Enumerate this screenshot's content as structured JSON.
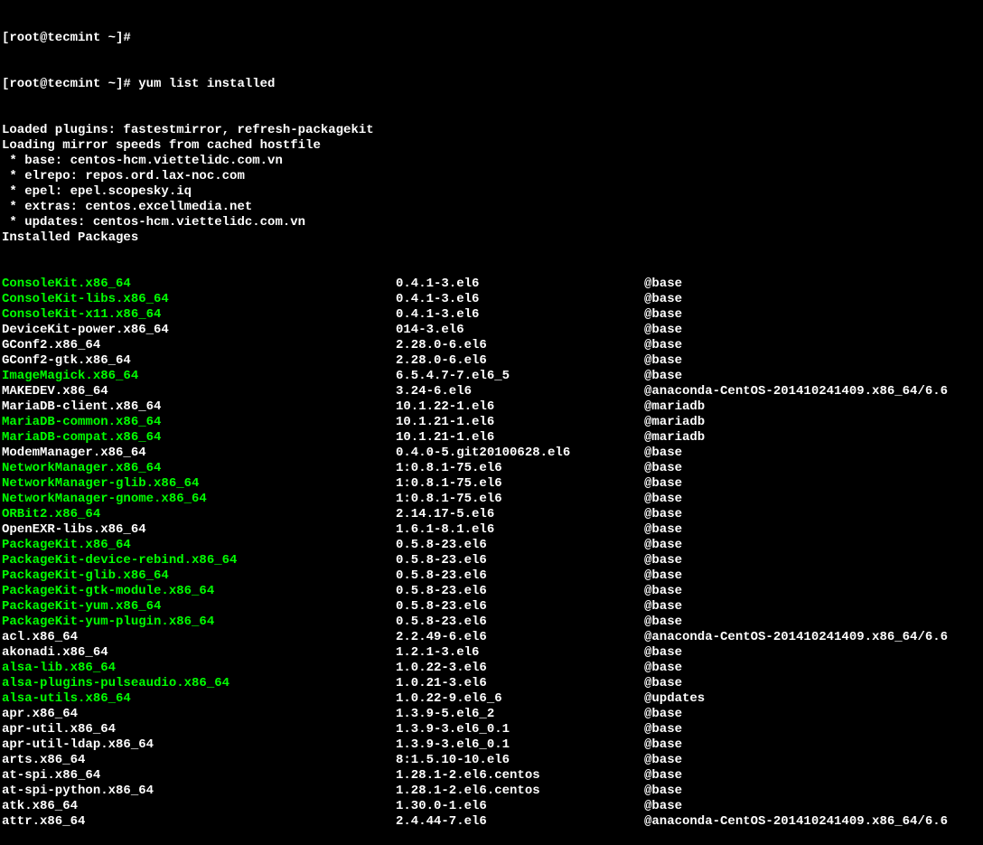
{
  "prompt": "[root@tecmint ~]#",
  "command": "yum list installed",
  "header_lines": [
    "Loaded plugins: fastestmirror, refresh-packagekit",
    "Loading mirror speeds from cached hostfile",
    " * base: centos-hcm.viettelidc.com.vn",
    " * elrepo: repos.ord.lax-noc.com",
    " * epel: epel.scopesky.iq",
    " * extras: centos.excellmedia.net",
    " * updates: centos-hcm.viettelidc.com.vn",
    "Installed Packages"
  ],
  "packages": [
    {
      "name": "ConsoleKit.x86_64",
      "version": "0.4.1-3.el6",
      "repo": "@base",
      "highlight": true
    },
    {
      "name": "ConsoleKit-libs.x86_64",
      "version": "0.4.1-3.el6",
      "repo": "@base",
      "highlight": true
    },
    {
      "name": "ConsoleKit-x11.x86_64",
      "version": "0.4.1-3.el6",
      "repo": "@base",
      "highlight": true
    },
    {
      "name": "DeviceKit-power.x86_64",
      "version": "014-3.el6",
      "repo": "@base",
      "highlight": false
    },
    {
      "name": "GConf2.x86_64",
      "version": "2.28.0-6.el6",
      "repo": "@base",
      "highlight": false
    },
    {
      "name": "GConf2-gtk.x86_64",
      "version": "2.28.0-6.el6",
      "repo": "@base",
      "highlight": false
    },
    {
      "name": "ImageMagick.x86_64",
      "version": "6.5.4.7-7.el6_5",
      "repo": "@base",
      "highlight": true
    },
    {
      "name": "MAKEDEV.x86_64",
      "version": "3.24-6.el6",
      "repo": "@anaconda-CentOS-201410241409.x86_64/6.6",
      "highlight": false
    },
    {
      "name": "MariaDB-client.x86_64",
      "version": "10.1.22-1.el6",
      "repo": "@mariadb",
      "highlight": false
    },
    {
      "name": "MariaDB-common.x86_64",
      "version": "10.1.21-1.el6",
      "repo": "@mariadb",
      "highlight": true
    },
    {
      "name": "MariaDB-compat.x86_64",
      "version": "10.1.21-1.el6",
      "repo": "@mariadb",
      "highlight": true
    },
    {
      "name": "ModemManager.x86_64",
      "version": "0.4.0-5.git20100628.el6",
      "repo": "@base",
      "highlight": false
    },
    {
      "name": "NetworkManager.x86_64",
      "version": "1:0.8.1-75.el6",
      "repo": "@base",
      "highlight": true
    },
    {
      "name": "NetworkManager-glib.x86_64",
      "version": "1:0.8.1-75.el6",
      "repo": "@base",
      "highlight": true
    },
    {
      "name": "NetworkManager-gnome.x86_64",
      "version": "1:0.8.1-75.el6",
      "repo": "@base",
      "highlight": true
    },
    {
      "name": "ORBit2.x86_64",
      "version": "2.14.17-5.el6",
      "repo": "@base",
      "highlight": true
    },
    {
      "name": "OpenEXR-libs.x86_64",
      "version": "1.6.1-8.1.el6",
      "repo": "@base",
      "highlight": false
    },
    {
      "name": "PackageKit.x86_64",
      "version": "0.5.8-23.el6",
      "repo": "@base",
      "highlight": true
    },
    {
      "name": "PackageKit-device-rebind.x86_64",
      "version": "0.5.8-23.el6",
      "repo": "@base",
      "highlight": true
    },
    {
      "name": "PackageKit-glib.x86_64",
      "version": "0.5.8-23.el6",
      "repo": "@base",
      "highlight": true
    },
    {
      "name": "PackageKit-gtk-module.x86_64",
      "version": "0.5.8-23.el6",
      "repo": "@base",
      "highlight": true
    },
    {
      "name": "PackageKit-yum.x86_64",
      "version": "0.5.8-23.el6",
      "repo": "@base",
      "highlight": true
    },
    {
      "name": "PackageKit-yum-plugin.x86_64",
      "version": "0.5.8-23.el6",
      "repo": "@base",
      "highlight": true
    },
    {
      "name": "acl.x86_64",
      "version": "2.2.49-6.el6",
      "repo": "@anaconda-CentOS-201410241409.x86_64/6.6",
      "highlight": false
    },
    {
      "name": "akonadi.x86_64",
      "version": "1.2.1-3.el6",
      "repo": "@base",
      "highlight": false
    },
    {
      "name": "alsa-lib.x86_64",
      "version": "1.0.22-3.el6",
      "repo": "@base",
      "highlight": true
    },
    {
      "name": "alsa-plugins-pulseaudio.x86_64",
      "version": "1.0.21-3.el6",
      "repo": "@base",
      "highlight": true
    },
    {
      "name": "alsa-utils.x86_64",
      "version": "1.0.22-9.el6_6",
      "repo": "@updates",
      "highlight": true
    },
    {
      "name": "apr.x86_64",
      "version": "1.3.9-5.el6_2",
      "repo": "@base",
      "highlight": false
    },
    {
      "name": "apr-util.x86_64",
      "version": "1.3.9-3.el6_0.1",
      "repo": "@base",
      "highlight": false
    },
    {
      "name": "apr-util-ldap.x86_64",
      "version": "1.3.9-3.el6_0.1",
      "repo": "@base",
      "highlight": false
    },
    {
      "name": "arts.x86_64",
      "version": "8:1.5.10-10.el6",
      "repo": "@base",
      "highlight": false
    },
    {
      "name": "at-spi.x86_64",
      "version": "1.28.1-2.el6.centos",
      "repo": "@base",
      "highlight": false
    },
    {
      "name": "at-spi-python.x86_64",
      "version": "1.28.1-2.el6.centos",
      "repo": "@base",
      "highlight": false
    },
    {
      "name": "atk.x86_64",
      "version": "1.30.0-1.el6",
      "repo": "@base",
      "highlight": false
    },
    {
      "name": "attr.x86_64",
      "version": "2.4.44-7.el6",
      "repo": "@anaconda-CentOS-201410241409.x86_64/6.6",
      "highlight": false
    }
  ]
}
